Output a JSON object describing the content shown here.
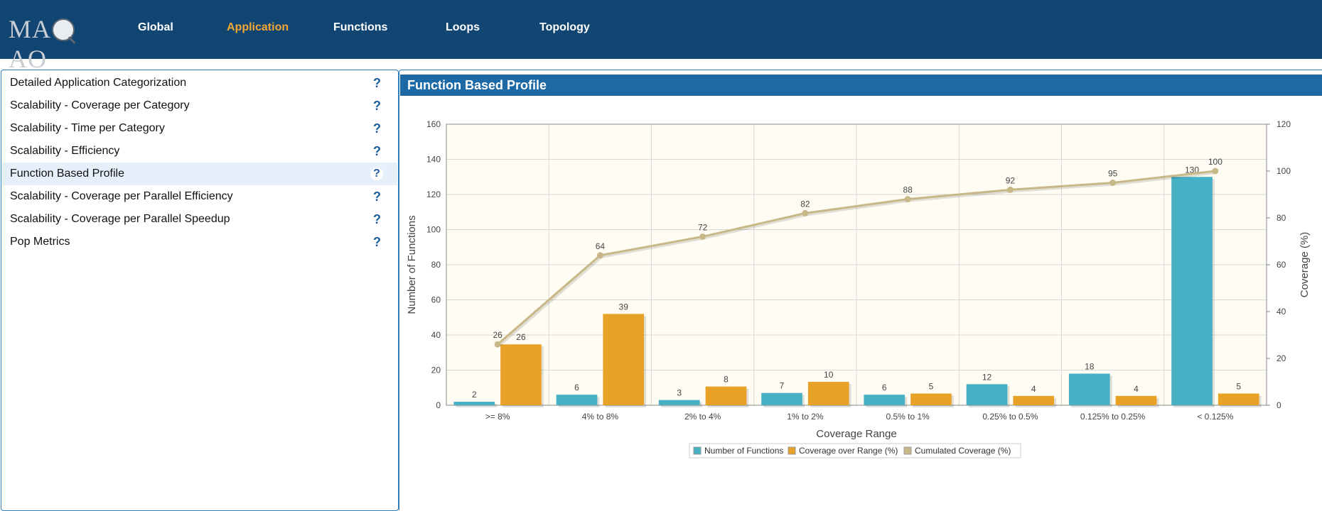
{
  "header": {
    "logo_text": "MAQAO",
    "nav": [
      {
        "label": "Global",
        "active": false
      },
      {
        "label": "Application",
        "active": true
      },
      {
        "label": "Functions",
        "active": false
      },
      {
        "label": "Loops",
        "active": false
      },
      {
        "label": "Topology",
        "active": false
      }
    ]
  },
  "sidebar": {
    "items": [
      {
        "label": "Detailed Application Categorization",
        "help": "?",
        "active": false
      },
      {
        "label": "Scalability - Coverage per Category",
        "help": "?",
        "active": false
      },
      {
        "label": "Scalability - Time per Category",
        "help": "?",
        "active": false
      },
      {
        "label": "Scalability - Efficiency",
        "help": "?",
        "active": false
      },
      {
        "label": "Function Based Profile",
        "help": "?",
        "active": true
      },
      {
        "label": "Scalability - Coverage per Parallel Efficiency",
        "help": "?",
        "active": false
      },
      {
        "label": "Scalability - Coverage per Parallel Speedup",
        "help": "?",
        "active": false
      },
      {
        "label": "Pop Metrics",
        "help": "?",
        "active": false
      }
    ]
  },
  "panel": {
    "title": "Function Based Profile"
  },
  "colors": {
    "header_bg": "#124672",
    "accent": "#f2a634",
    "functions_series": "#46b0c4",
    "coverage_series": "#e9a228",
    "cumulated_series": "#c9b887",
    "plot_bg": "#fffdf3"
  },
  "chart_data": {
    "type": "bar",
    "xlabel": "Coverage Range",
    "ylabel": "Number of Functions",
    "y2label": "Coverage (%)",
    "ylim": [
      0,
      160
    ],
    "y2lim": [
      0,
      120
    ],
    "yticks": [
      "0",
      "20",
      "40",
      "60",
      "80",
      "100",
      "120",
      "140",
      "160"
    ],
    "y2ticks": [
      "0",
      "20",
      "40",
      "60",
      "80",
      "100",
      "120"
    ],
    "grid": true,
    "legend_position": "bottom-center",
    "categories": [
      ">= 8%",
      "4% to 8%",
      "2% to 4%",
      "1% to 2%",
      "0.5% to 1%",
      "0.25% to 0.5%",
      "0.125% to 0.25%",
      "< 0.125%"
    ],
    "series": [
      {
        "name": "Number of Functions",
        "type": "bar",
        "axis": "left",
        "values": [
          2,
          6,
          3,
          7,
          6,
          12,
          18,
          130
        ]
      },
      {
        "name": "Coverage over Range (%)",
        "type": "bar",
        "axis": "right",
        "values": [
          26,
          39,
          8,
          10,
          5,
          4,
          4,
          5
        ]
      },
      {
        "name": "Cumulated Coverage (%)",
        "type": "line",
        "axis": "right",
        "values": [
          26,
          64,
          72,
          82,
          88,
          92,
          95,
          100
        ]
      }
    ]
  }
}
